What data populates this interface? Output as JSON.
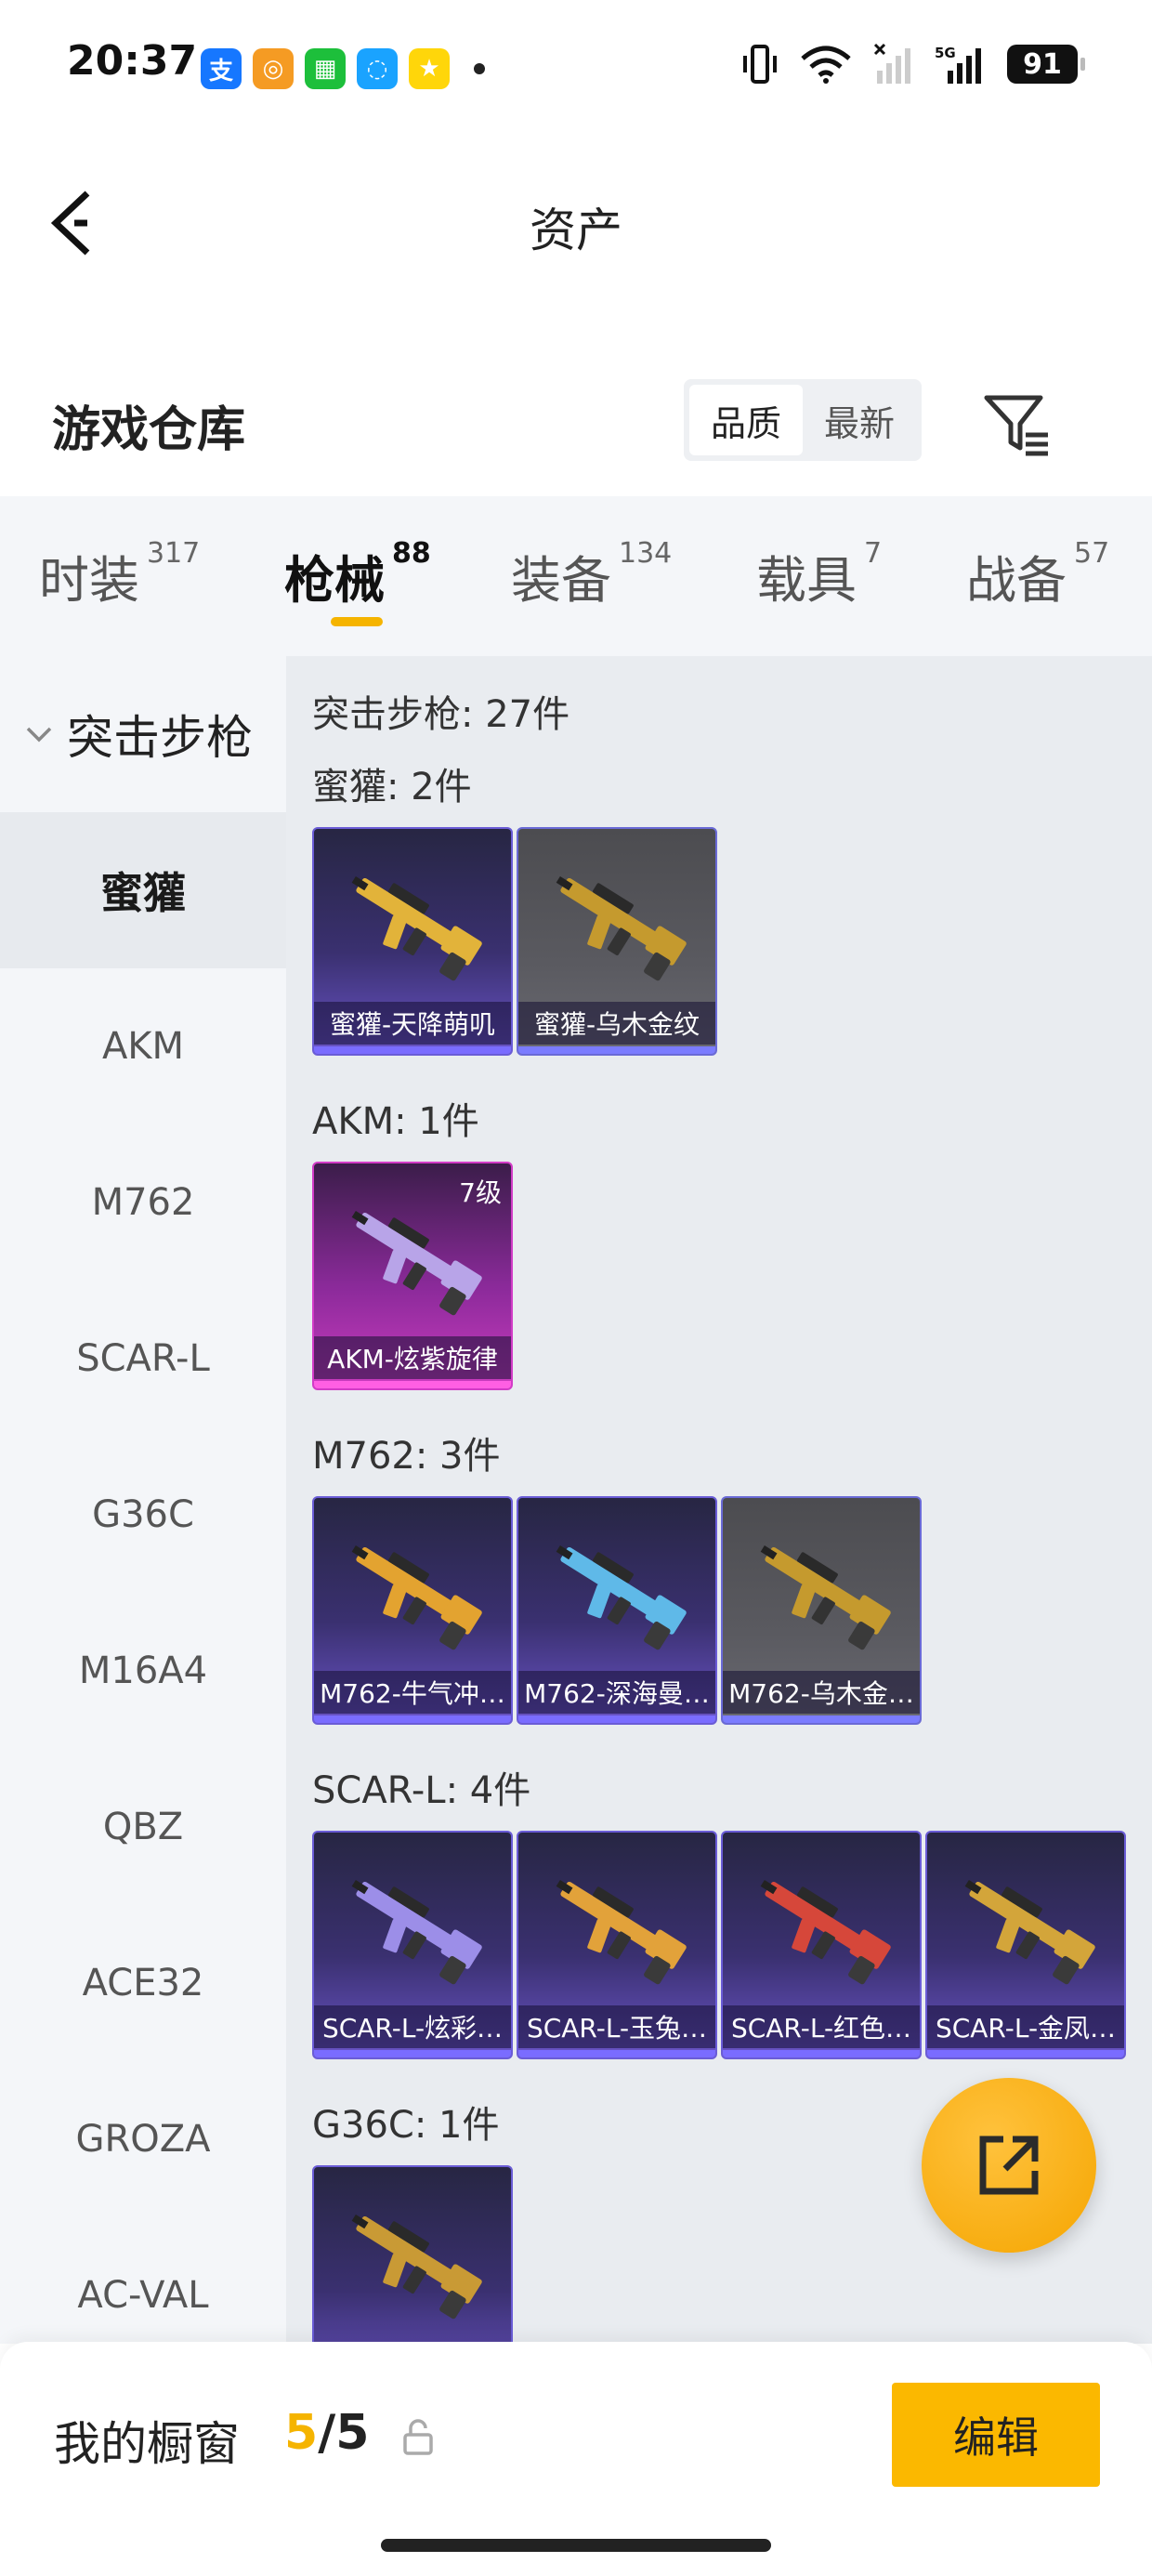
{
  "status_bar": {
    "time": "20:37",
    "apps": [
      {
        "icon": "alipay-icon",
        "glyph": "支",
        "color": "#1677ff"
      },
      {
        "icon": "target-app-icon",
        "glyph": "◎",
        "color": "#f59b23"
      },
      {
        "icon": "grid-app-icon",
        "glyph": "▦",
        "color": "#1dbf3b"
      },
      {
        "icon": "chat-app-icon",
        "glyph": "◌",
        "color": "#1aa3ff"
      },
      {
        "icon": "game-app-icon",
        "glyph": "★",
        "color": "#ffd60a"
      }
    ],
    "battery": "91",
    "network": "5G"
  },
  "nav": {
    "title": "资产"
  },
  "header": {
    "title": "游戏仓库",
    "sort_options": [
      "品质",
      "最新"
    ],
    "sort_active": 0
  },
  "tabs": [
    {
      "label": "时装",
      "count": "317"
    },
    {
      "label": "枪械",
      "count": "88"
    },
    {
      "label": "装备",
      "count": "134"
    },
    {
      "label": "载具",
      "count": "7"
    },
    {
      "label": "战备",
      "count": "57"
    }
  ],
  "active_tab": 1,
  "sidebar": {
    "group": "突击步枪",
    "items": [
      "蜜獾",
      "AKM",
      "M762",
      "SCAR-L",
      "G36C",
      "M16A4",
      "QBZ",
      "ACE32",
      "GROZA",
      "AC-VAL"
    ],
    "active": 0
  },
  "content": {
    "header": "突击步枪: 27件",
    "groups": [
      {
        "title": "蜜獾: 2件",
        "cards": [
          {
            "name": "蜜獾-天降萌叽",
            "style": "purple",
            "gun": "#e2b33a"
          },
          {
            "name": "蜜獾-乌木金纹",
            "style": "grey",
            "gun": "#c59a2e"
          }
        ]
      },
      {
        "title": "AKM: 1件",
        "cards": [
          {
            "name": "AKM-炫紫旋律",
            "style": "pink",
            "gun": "#b8a4e8",
            "level": "7级"
          }
        ]
      },
      {
        "title": "M762: 3件",
        "cards": [
          {
            "name": "M762-牛气冲…",
            "style": "purple",
            "gun": "#e3a330"
          },
          {
            "name": "M762-深海曼…",
            "style": "purple",
            "gun": "#5fb9e8"
          },
          {
            "name": "M762-乌木金…",
            "style": "grey",
            "gun": "#c59a2e"
          }
        ]
      },
      {
        "title": "SCAR-L: 4件",
        "cards": [
          {
            "name": "SCAR-L-炫彩…",
            "style": "purple",
            "gun": "#9c8ee8"
          },
          {
            "name": "SCAR-L-玉兔…",
            "style": "purple",
            "gun": "#e2a23a"
          },
          {
            "name": "SCAR-L-红色…",
            "style": "purple",
            "gun": "#d6473a"
          },
          {
            "name": "SCAR-L-金凤…",
            "style": "purple",
            "gun": "#d3a53a"
          }
        ]
      },
      {
        "title": "G36C: 1件",
        "cards": [
          {
            "name": "",
            "style": "purple",
            "gun": "#c99a35"
          }
        ]
      }
    ]
  },
  "bottom_bar": {
    "label": "我的橱窗",
    "current": "5",
    "separator": "/",
    "total": "5",
    "edit": "编辑"
  },
  "colors": {
    "accent": "#f5b400",
    "edit_button": "#fbb800",
    "rare_purple": "#6a5cd6",
    "legendary_pink": "#d23cc7"
  }
}
